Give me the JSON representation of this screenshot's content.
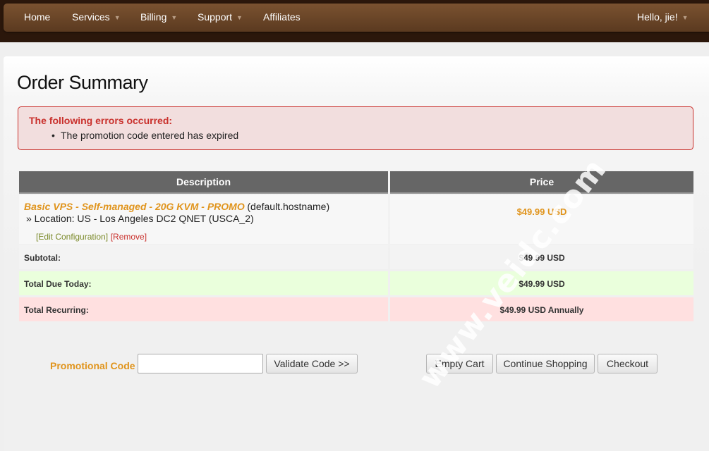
{
  "nav": {
    "home": "Home",
    "services": "Services",
    "billing": "Billing",
    "support": "Support",
    "affiliates": "Affiliates",
    "user": "Hello, jie!"
  },
  "page_title": "Order Summary",
  "errors": {
    "title": "The following errors occurred:",
    "items": [
      "The promotion code entered has expired"
    ]
  },
  "table": {
    "headers": [
      "Description",
      "Price"
    ],
    "item": {
      "name": "Basic VPS - Self-managed - 20G KVM - PROMO",
      "hostname": "(default.hostname)",
      "location": "» Location: US - Los Angeles DC2 QNET (USCA_2)",
      "price": "$49.99 USD",
      "edit": "[Edit Configuration]",
      "remove": "[Remove]"
    },
    "subtotal": {
      "label": "Subtotal:",
      "value": "$49.99 USD"
    },
    "total_due": {
      "label": "Total Due Today:",
      "value": "$49.99 USD"
    },
    "recurring": {
      "label": "Total Recurring:",
      "value": "$49.99 USD Annually"
    }
  },
  "promo": {
    "label": "Promotional Code",
    "value": "",
    "validate": "Validate Code >>"
  },
  "buttons": {
    "empty_cart": "Empty Cart",
    "continue": "Continue Shopping",
    "checkout": "Checkout"
  },
  "watermark": "www.veidc.com",
  "colors": {
    "accent_orange": "#e0941c",
    "error_red": "#c9302c",
    "due_green": "#eaffdc",
    "recurring_pink": "#ffe0e0"
  }
}
